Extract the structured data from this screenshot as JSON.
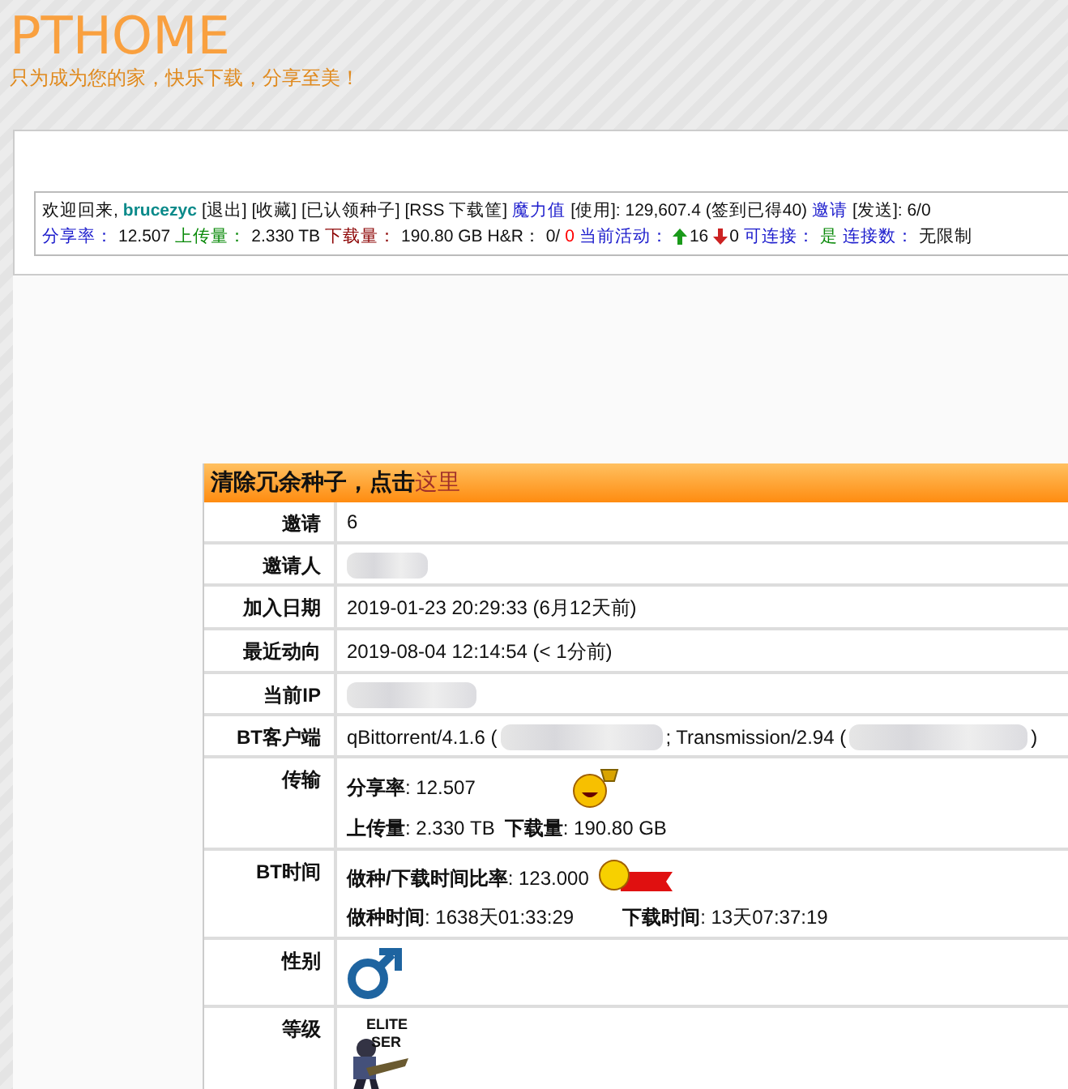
{
  "header": {
    "title": "PTHOME",
    "slogan": "只为成为您的家，快乐下载，分享至美！"
  },
  "info_bar": {
    "line1": [
      {
        "kind": "plain",
        "text": "欢迎回来,"
      },
      {
        "kind": "user",
        "text": "brucezyc"
      },
      {
        "kind": "plain",
        "text": "[退出] [收藏] [已认领种子] [RSS 下载筐]"
      },
      {
        "kind": "link",
        "text": "魔力值"
      },
      {
        "kind": "plain",
        "text": "[使用]: 129,607.4 (签到已得40)"
      },
      {
        "kind": "link",
        "text": "邀请"
      },
      {
        "kind": "plain",
        "text": "[发送]: 6/0"
      }
    ],
    "line2": [
      {
        "kind": "label",
        "text": "分享率：",
        "color": "#1a1acc"
      },
      {
        "kind": "value",
        "text": "12.507"
      },
      {
        "kind": "label",
        "text": "上传量：",
        "color": "#0a8a0a"
      },
      {
        "kind": "value",
        "text": "2.330 TB"
      },
      {
        "kind": "label",
        "text": "下载量：",
        "color": "#8b0000"
      },
      {
        "kind": "value",
        "text": "190.80 GB"
      },
      {
        "kind": "value",
        "text": "H&R：  0/"
      },
      {
        "kind": "label",
        "text": "0",
        "color": "#ff0000"
      },
      {
        "kind": "label",
        "text": "当前活动：",
        "color": "#1a1acc"
      },
      {
        "kind": "up",
        "text": "16"
      },
      {
        "kind": "down",
        "text": "0"
      },
      {
        "kind": "label",
        "text": "可连接：",
        "color": "#1a1acc"
      },
      {
        "kind": "label",
        "text": "是",
        "color": "#0a8a0a"
      },
      {
        "kind": "label",
        "text": "连接数：",
        "color": "#1a1acc"
      },
      {
        "kind": "value",
        "text": "无限制"
      }
    ]
  },
  "banner": {
    "text": "清除冗余种子，点击",
    "link": "这里"
  },
  "rows": [
    {
      "kind": "text",
      "label": "邀请",
      "value": "6"
    },
    {
      "kind": "redacted",
      "label": "邀请人"
    },
    {
      "kind": "text",
      "label": "加入日期",
      "value": "2019-01-23 20:29:33 (6月12天前)"
    },
    {
      "kind": "text",
      "label": "最近动向",
      "value": "2019-08-04 12:14:54 (< 1分前)"
    },
    {
      "kind": "redacted",
      "label": "当前IP"
    },
    {
      "kind": "clients",
      "label": "BT客户端",
      "clients": [
        "qBittorrent/4.1.6 (",
        "; Transmission/2.94 (",
        ")"
      ]
    },
    {
      "kind": "transfer",
      "label": "传输",
      "ratio_label": "分享率",
      "ratio": ": 12.507",
      "up_label": "上传量",
      "up": ": 2.330 TB",
      "down_label": "下载量",
      "down": ": 190.80 GB"
    },
    {
      "kind": "bttime",
      "label": "BT时间",
      "ratio_label": "做种/下载时间比率",
      "ratio": ": 123.000",
      "seed_label": "做种时间",
      "seed": ": 1638天01:33:29",
      "dl_label": "下载时间",
      "dl": ": 13天07:37:19"
    },
    {
      "kind": "gender",
      "label": "性别"
    },
    {
      "kind": "rank",
      "label": "等级",
      "rank_lines": [
        "ELITE",
        "SER"
      ]
    }
  ]
}
